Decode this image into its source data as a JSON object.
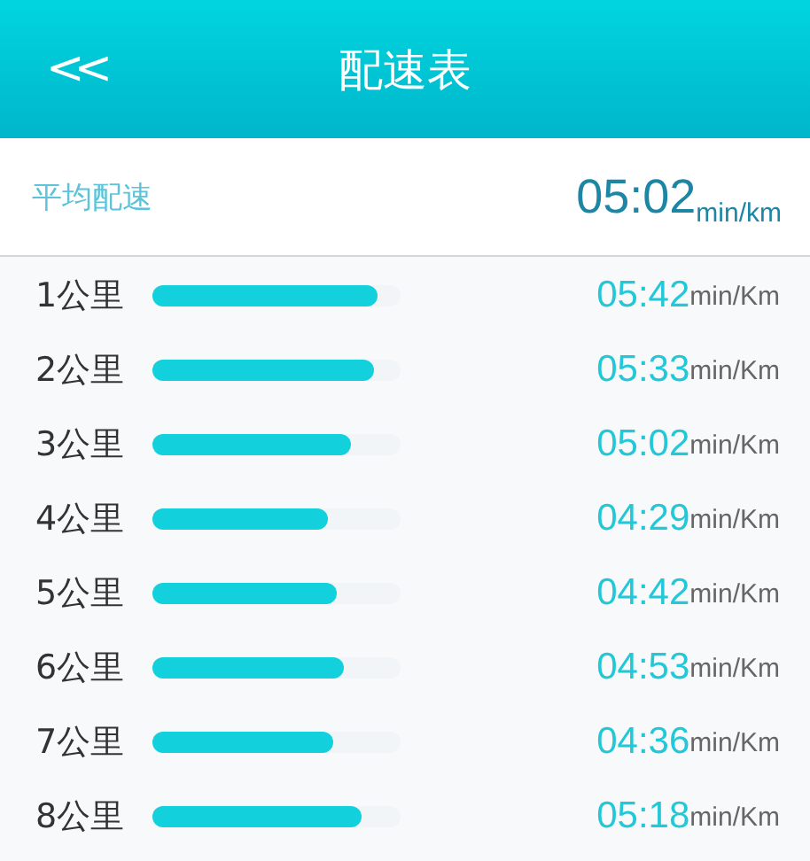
{
  "header": {
    "back": "<<",
    "title": "配速表"
  },
  "average": {
    "label": "平均配速",
    "value": "05:02",
    "unit": "min/km"
  },
  "splits": [
    {
      "label": "1公里",
      "level": 0.91,
      "pace": "05:42",
      "unit": "min/Km"
    },
    {
      "label": "2公里",
      "level": 0.89,
      "pace": "05:33",
      "unit": "min/Km"
    },
    {
      "label": "3公里",
      "level": 0.8,
      "pace": "05:02",
      "unit": "min/Km"
    },
    {
      "label": "4公里",
      "level": 0.71,
      "pace": "04:29",
      "unit": "min/Km"
    },
    {
      "label": "5公里",
      "level": 0.74,
      "pace": "04:42",
      "unit": "min/Km"
    },
    {
      "label": "6公里",
      "level": 0.77,
      "pace": "04:53",
      "unit": "min/Km"
    },
    {
      "label": "7公里",
      "level": 0.73,
      "pace": "04:36",
      "unit": "min/Km"
    },
    {
      "label": "8公里",
      "level": 0.84,
      "pace": "05:18",
      "unit": "min/Km"
    }
  ]
}
